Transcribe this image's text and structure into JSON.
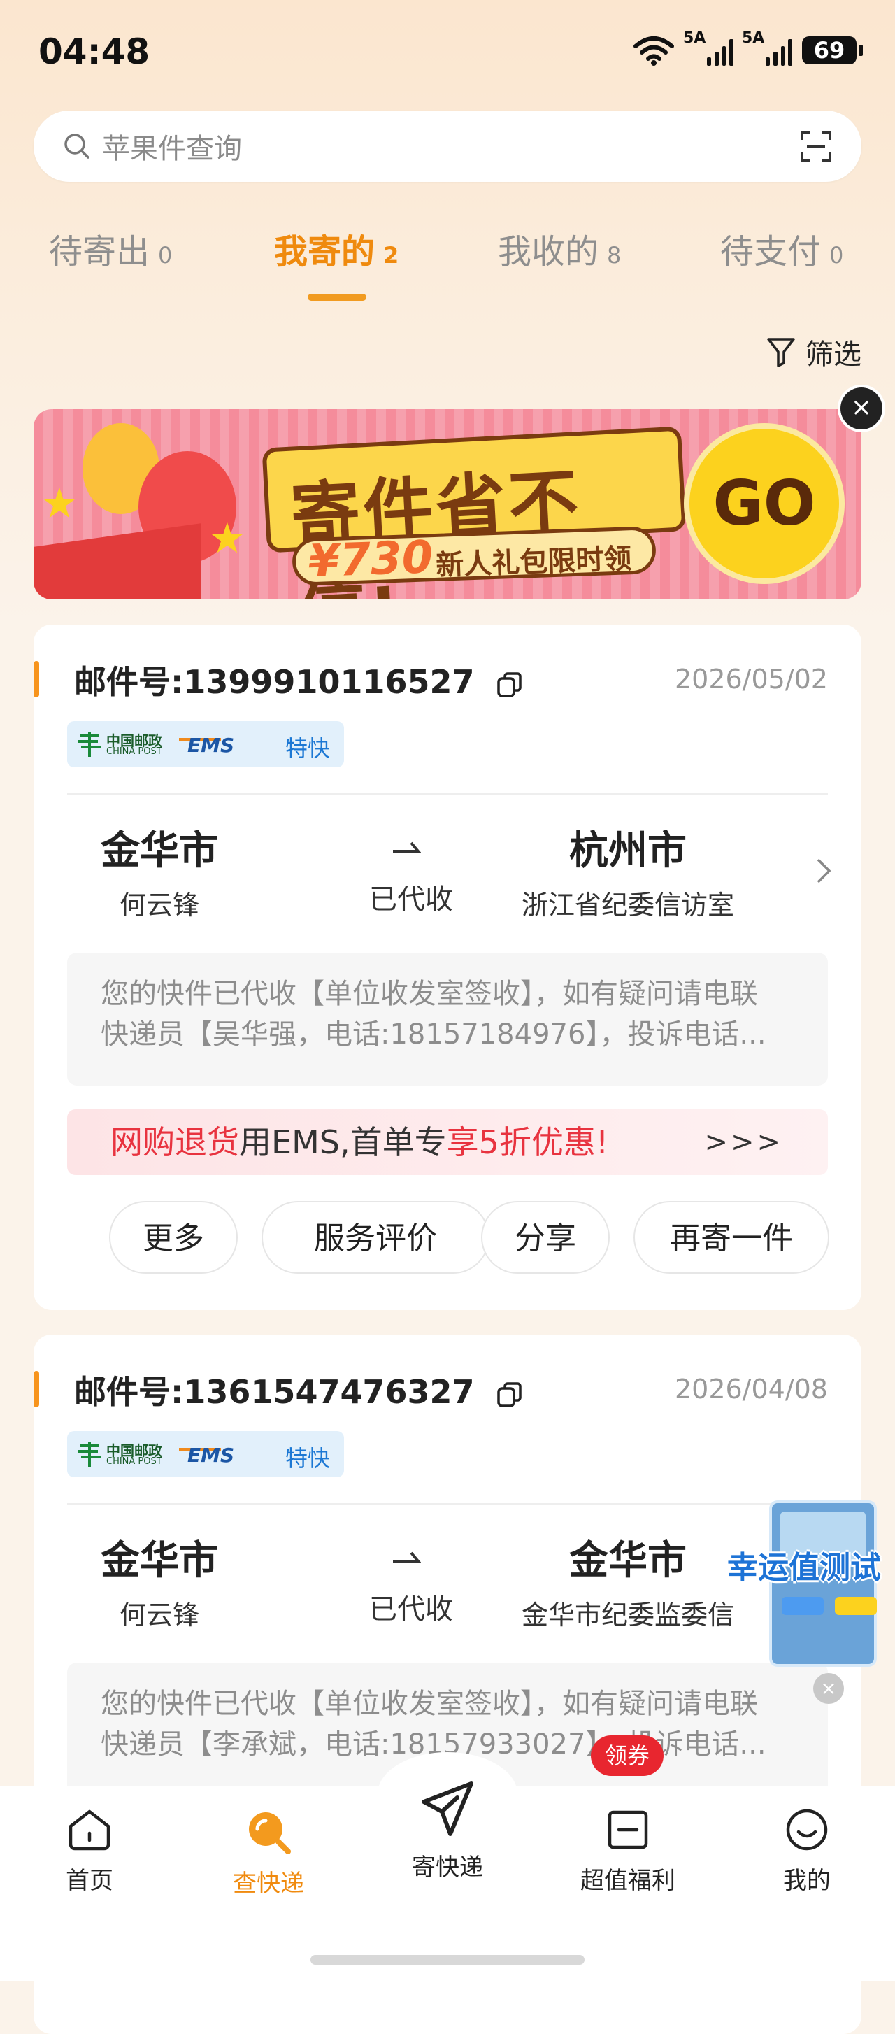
{
  "status_bar": {
    "time": "04:48",
    "signal_1": "5A",
    "signal_2": "5A",
    "battery": "69"
  },
  "search": {
    "placeholder": "苹果件查询"
  },
  "tabs": [
    {
      "label": "待寄出",
      "count": "0"
    },
    {
      "label": "我寄的",
      "count": "2"
    },
    {
      "label": "我收的",
      "count": "8"
    },
    {
      "label": "待支付",
      "count": "0"
    }
  ],
  "filter_label": "筛选",
  "banner": {
    "title": "寄件省不停!",
    "amount": "¥730",
    "subtitle": "新人礼包限时领",
    "go": "GO",
    "close": "×"
  },
  "shipments": [
    {
      "mail_label": "邮件号:",
      "number": "1399910116527",
      "date": "2026/05/02",
      "carrier_cn": "中国邮政",
      "carrier_en": "CHINA POST",
      "carrier_brand": "EMS",
      "service": "特快",
      "from_city": "金华市",
      "from_person": "何云锋",
      "status": "已代收",
      "to_city": "杭州市",
      "to_person": "浙江省纪委信访室",
      "message_line1": "您的快件已代收【单位收发室签收】，如有疑问请电联",
      "message_line2": "快递员【吴华强，电话:18157184976】，投诉电话..."
    },
    {
      "mail_label": "邮件号:",
      "number": "1361547476327",
      "date": "2026/04/08",
      "carrier_cn": "中国邮政",
      "carrier_en": "CHINA POST",
      "carrier_brand": "EMS",
      "service": "特快",
      "from_city": "金华市",
      "from_person": "何云锋",
      "status": "已代收",
      "to_city": "金华市",
      "to_person": "金华市纪委监委信",
      "message_line1": "您的快件已代收【单位收发室签收】，如有疑问请电联",
      "message_line2": "快递员【李承斌，电话:18157933027】，投诉电话..."
    }
  ],
  "promo": {
    "part1": "网购退货",
    "part2": "用EMS,首单专",
    "part3": "享5折优惠!",
    "more": ">>>"
  },
  "actions": [
    "更多",
    "服务评价",
    "分享",
    "再寄一件"
  ],
  "float_widget": {
    "label": "幸运值测试",
    "close": "×"
  },
  "bottom_nav": {
    "items": [
      "首页",
      "查快递",
      "寄快递",
      "超值福利",
      "我的"
    ],
    "coupon_badge": "领券"
  },
  "colors": {
    "accent": "#f08a0e",
    "promo_red": "#e8333f",
    "ems_blue": "#1c56a5"
  }
}
